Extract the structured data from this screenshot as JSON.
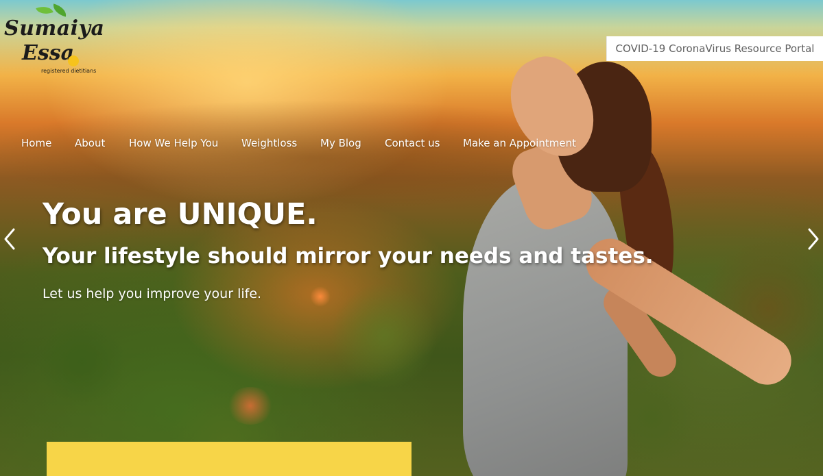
{
  "brand": {
    "name_line1": "Sumaiya",
    "name_line2": "Essa",
    "tagline": "registered dietitians"
  },
  "covid_link": {
    "label": "COVID-19 CoronaVirus Resource Portal"
  },
  "nav": {
    "items": [
      {
        "label": "Home"
      },
      {
        "label": "About"
      },
      {
        "label": "How We Help You"
      },
      {
        "label": "Weightloss"
      },
      {
        "label": "My Blog"
      },
      {
        "label": "Contact us"
      },
      {
        "label": "Make an Appointment"
      }
    ]
  },
  "hero": {
    "headline": "You are UNIQUE.",
    "subheadline": "Your lifestyle should mirror your needs and tastes.",
    "tagline": "Let us help you improve your life."
  },
  "slider": {
    "prev_icon": "chevron-left-icon",
    "next_icon": "chevron-right-icon"
  },
  "colors": {
    "cta_yellow": "#f7d548",
    "nav_text": "#ffffff",
    "covid_text": "#5f5f5f"
  }
}
